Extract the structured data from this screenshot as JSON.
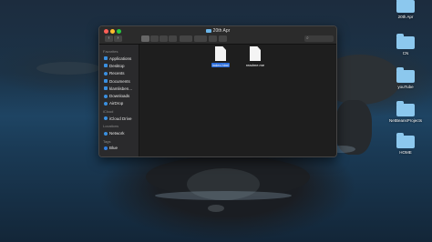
{
  "window": {
    "title": "20th Apr"
  },
  "toolbar": {
    "back": "‹",
    "forward": "›",
    "search_icon": "search-icon"
  },
  "sidebar": {
    "favorites_heading": "Favorites",
    "favorites": [
      {
        "label": "Applications",
        "icon": "applications-icon"
      },
      {
        "label": "Desktop",
        "icon": "desktop-icon"
      },
      {
        "label": "Recents",
        "icon": "recents-icon"
      },
      {
        "label": "Documents",
        "icon": "documents-icon"
      },
      {
        "label": "klamlisben...",
        "icon": "home-icon"
      },
      {
        "label": "Downloads",
        "icon": "downloads-icon"
      },
      {
        "label": "AirDrop",
        "icon": "airdrop-icon"
      }
    ],
    "icloud_heading": "iCloud",
    "icloud": [
      {
        "label": "iCloud Drive",
        "icon": "icloud-icon"
      }
    ],
    "locations_heading": "Locations",
    "locations": [
      {
        "label": "Network",
        "icon": "network-icon"
      }
    ],
    "tags_heading": "Tags",
    "tags": [
      {
        "label": "Blue",
        "icon": "blue-tag-icon",
        "color": "#2f7de1"
      }
    ]
  },
  "files": [
    {
      "name": "index.html",
      "selected": true
    },
    {
      "name": "readme.me",
      "selected": false
    }
  ],
  "desktop": {
    "items": [
      {
        "label": "20th Apr"
      },
      {
        "label": "CN"
      },
      {
        "label": "youTube"
      },
      {
        "label": "NetBeansProjects"
      },
      {
        "label": "HOME"
      }
    ]
  },
  "colors": {
    "selection": "#2a6bd9",
    "folder": "#8cc8ee"
  }
}
